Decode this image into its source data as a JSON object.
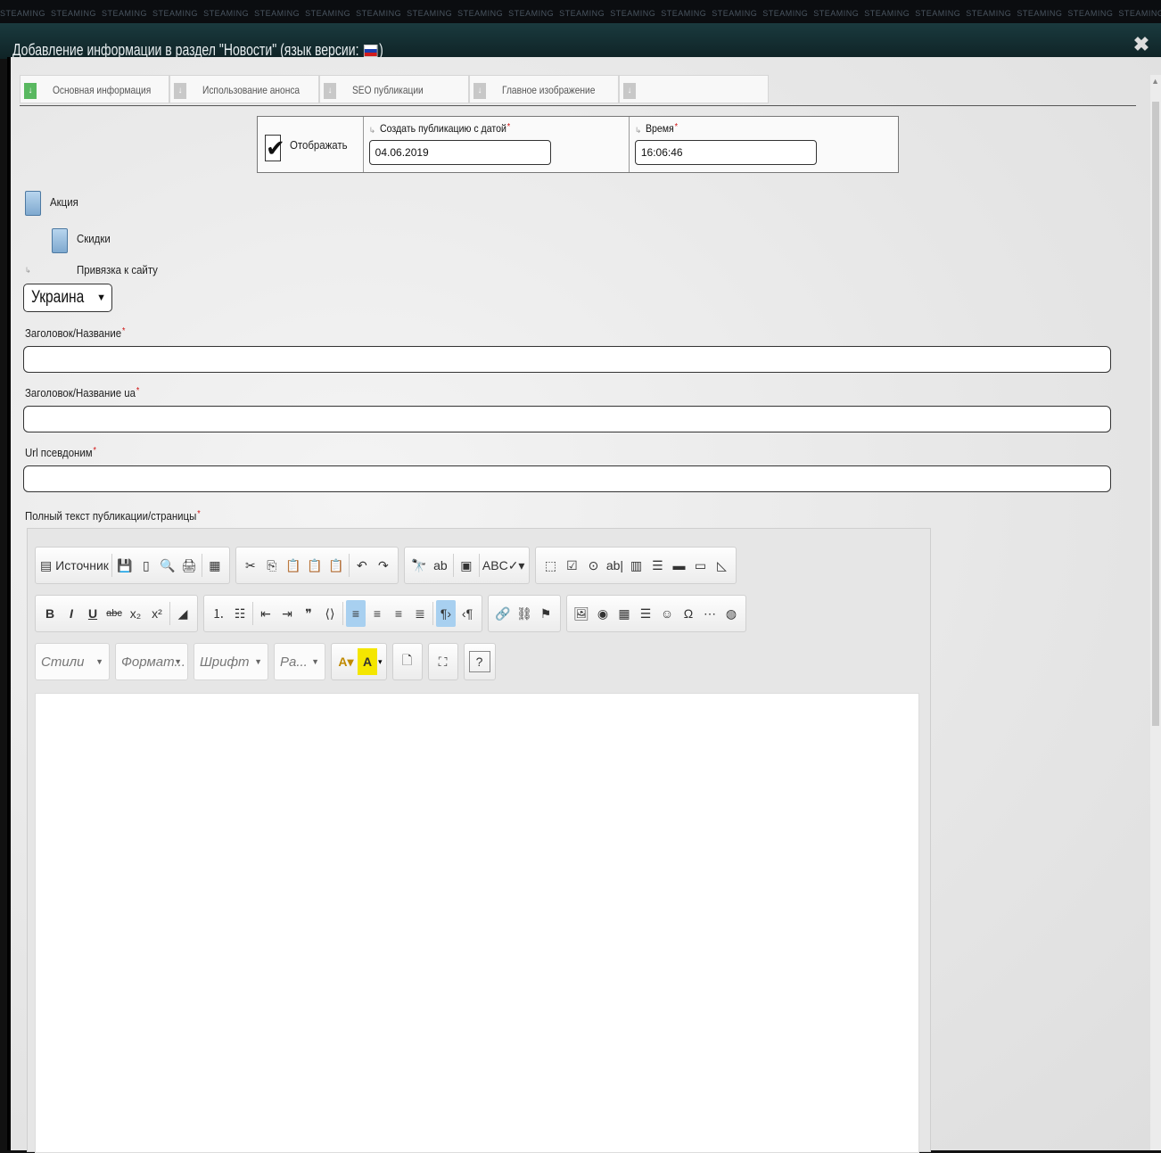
{
  "watermark_text": "STEAMING",
  "window": {
    "title_prefix": "Добавление информации в раздел \"Новости\" (язык версии:",
    "title_suffix": ")"
  },
  "tabs": [
    {
      "label": "Основная информация"
    },
    {
      "label": "Использование анонса"
    },
    {
      "label": "SEO публикации"
    },
    {
      "label": "Главное изображение"
    },
    {
      "label": ""
    }
  ],
  "publish": {
    "display_label": "Отображать",
    "display_checked": true,
    "date_label": "Создать публикацию с датой",
    "date_value": "04.06.2019",
    "time_label": "Время",
    "time_value": "16:06:46",
    "required_mark": "*"
  },
  "checks": {
    "action_label": "Акция",
    "discounts_label": "Скидки"
  },
  "site": {
    "label": "Привязка к сайту",
    "value": "Украина"
  },
  "fields": {
    "title_label": "Заголовок/Название",
    "title_ua_label": "Заголовок/Название ua",
    "url_label": "Url псевдоним",
    "full_text_label": "Полный текст публикации/страницы"
  },
  "editor": {
    "source_label": "Источник",
    "styles_placeholder": "Стили",
    "format_placeholder": "Формат...",
    "font_placeholder": "Шрифт",
    "size_placeholder": "Ра..."
  },
  "colors": {
    "titlebar": "#12292c",
    "tab_active_arrow": "#59b860",
    "required": "#d01010",
    "checkbox_blue": "#7fa9cf"
  }
}
